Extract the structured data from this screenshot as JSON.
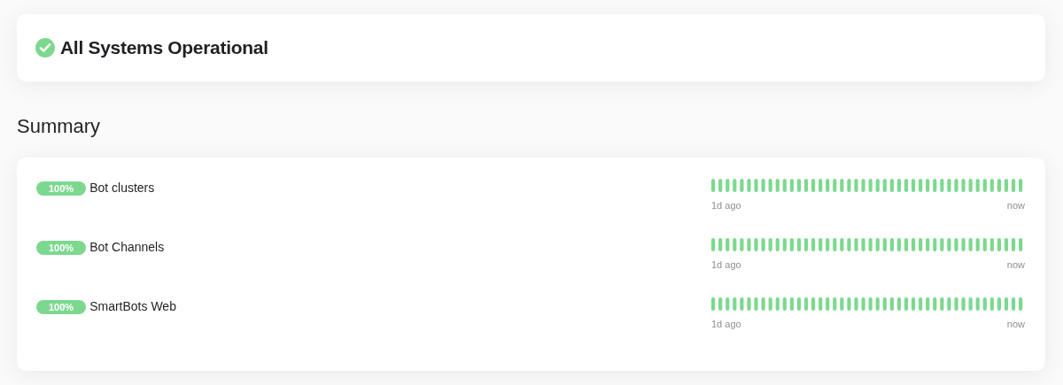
{
  "status": {
    "title": "All Systems Operational"
  },
  "summary": {
    "heading": "Summary",
    "services": [
      {
        "uptime": "100%",
        "name": "Bot clusters",
        "start_label": "1d ago",
        "end_label": "now"
      },
      {
        "uptime": "100%",
        "name": "Bot Channels",
        "start_label": "1d ago",
        "end_label": "now"
      },
      {
        "uptime": "100%",
        "name": "SmartBots Web",
        "start_label": "1d ago",
        "end_label": "now"
      }
    ]
  }
}
